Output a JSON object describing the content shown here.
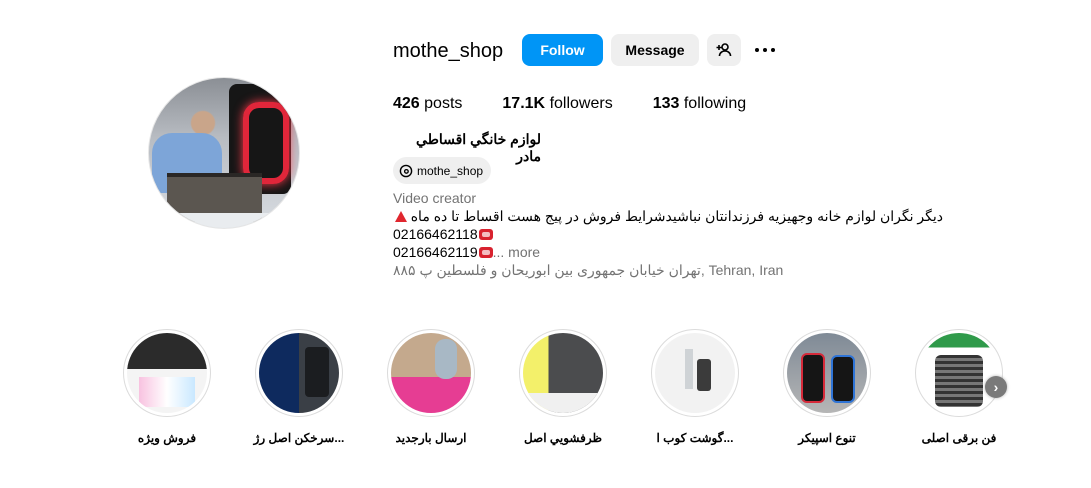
{
  "profile": {
    "username": "mothe_shop",
    "full_name": "لوازم خانگي اقساطي مادر",
    "threads_handle": "mothe_shop",
    "category": "Video creator",
    "bio_line1": "دیگر نگران لوازم خانه وجهیزیه فرزندانتان نباشیدشرایط فروش در پیج هست  اقساط تا ده ماه",
    "bio_line2": "02166462118",
    "bio_line3": "02166462119",
    "more_label": "... more",
    "address": "تهران خیابان جمهوری بین ابوریحان و فلسطین پ ۸۸۵, Tehran, Iran"
  },
  "actions": {
    "follow_label": "Follow",
    "message_label": "Message"
  },
  "stats": {
    "posts_count": "426",
    "posts_label": "posts",
    "followers_count": "17.1K",
    "followers_label": "followers",
    "following_count": "133",
    "following_label": "following"
  },
  "highlights": [
    {
      "label": "فروش ويژه"
    },
    {
      "label": "سرخکن اصل رژ..."
    },
    {
      "label": "ارسال بارجديد"
    },
    {
      "label": "ظرفشويي اصل"
    },
    {
      "label": "گوشت کوب ا..."
    },
    {
      "label": "تنوع اسپيکر"
    },
    {
      "label": "فن برقی اصلی"
    }
  ],
  "icons": {
    "add_user": "add-user-icon",
    "more": "more-horizontal-icon",
    "threads": "threads-icon",
    "phone": "telephone-icon",
    "warning": "red-triangle-icon",
    "next": "chevron-right-icon"
  },
  "colors": {
    "follow_button": "#0095f6",
    "secondary_button": "#efefef",
    "muted_text": "#737373"
  }
}
